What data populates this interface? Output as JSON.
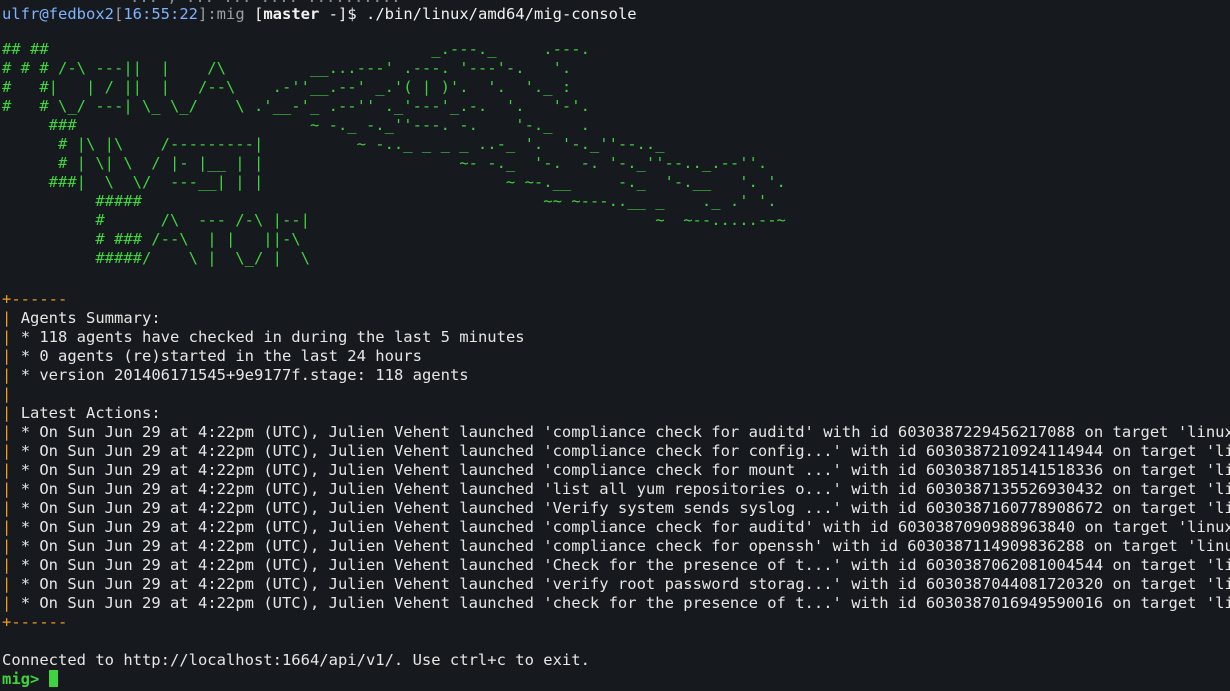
{
  "colors": {
    "background": "#16191d",
    "text": "#e6e6e6",
    "prompt_user": "#7fb3ff",
    "prompt_time": "#7fb3ff",
    "ascii": "#3fd43f",
    "orange": "#f29b1d",
    "mig_prompt": "#3fd43f"
  },
  "top_fragment": "... , ... ... .... ..........",
  "prompt": {
    "user_host": "ulfr@fedbox2",
    "time": "16:55:22",
    "dir": "mig",
    "branch": "master",
    "branch_suffix": " -]$ ",
    "command": "./bin/linux/amd64/mig-console"
  },
  "ascii_banner": "## ##                                         _.---._     .---.\n# # # /-\\ ---||  |    /\\         __...---' .---. '---'-.   '.\n#   #|   | / ||  |   /--\\    .-''__.--' _.'( | )'.  '.  '._ :\n#   # \\_/ ---| \\_ \\_/    \\ .'__-'_ .--'' ._'---'_.-.  '.   '-'.\n     ###                         ~ -._ -._''---. -.    '-._   .\n      # |\\ |\\    /---------|          ~ -.._ _ _ _ ..-_ '.  '-._''--.._\n      # | \\| \\  / |- |__ | |                     ~- -._  '-.  -. '-._''--.._.--''.\n     ###|  \\  \\/  ---__| | |                          ~ ~-.__     -._  '-.__   '. '.\n          #####                                           ~~ ~---..__ _    ._ .' '.\n          #      /\\  --- /-\\ |--|                                     ~  ~--.....--~\n          # ### /--\\  | |   ||-\\\n          #####/    \\ |  \\_/ |  \\",
  "separator_top": "+------",
  "separator_bottom": "+------",
  "bar": "|",
  "agents_summary": {
    "title": "Agents Summary:",
    "lines": [
      "* 118 agents have checked in during the last 5 minutes",
      "* 0 agents (re)started in the last 24 hours",
      "* version 201406171545+9e9177f.stage: 118 agents"
    ]
  },
  "latest_actions": {
    "title": "Latest Actions:",
    "lines": [
      "* On Sun Jun 29 at 4:22pm (UTC), Julien Vehent launched 'compliance check for auditd' with id 6030387229456217088 on target 'linux'",
      "* On Sun Jun 29 at 4:22pm (UTC), Julien Vehent launched 'compliance check for config...' with id 6030387210924114944 on target 'linux'",
      "* On Sun Jun 29 at 4:22pm (UTC), Julien Vehent launched 'compliance check for mount ...' with id 6030387185141518336 on target 'linux'",
      "* On Sun Jun 29 at 4:22pm (UTC), Julien Vehent launched 'list all yum repositories o...' with id 6030387135526930432 on target 'linux'",
      "* On Sun Jun 29 at 4:22pm (UTC), Julien Vehent launched 'Verify system sends syslog ...' with id 6030387160778908672 on target 'linux'",
      "* On Sun Jun 29 at 4:22pm (UTC), Julien Vehent launched 'compliance check for auditd' with id 6030387090988963840 on target 'linux'",
      "* On Sun Jun 29 at 4:22pm (UTC), Julien Vehent launched 'compliance check for openssh' with id 6030387114909836288 on target 'linux'",
      "* On Sun Jun 29 at 4:22pm (UTC), Julien Vehent launched 'Check for the presence of t...' with id 6030387062081004544 on target 'linux'",
      "* On Sun Jun 29 at 4:22pm (UTC), Julien Vehent launched 'verify root password storag...' with id 6030387044081720320 on target 'linux'",
      "* On Sun Jun 29 at 4:22pm (UTC), Julien Vehent launched 'check for the presence of t...' with id 6030387016949590016 on target 'linux'"
    ]
  },
  "connected_message": "Connected to http://localhost:1664/api/v1/. Use ctrl+c to exit.",
  "mig_prompt": "mig>"
}
